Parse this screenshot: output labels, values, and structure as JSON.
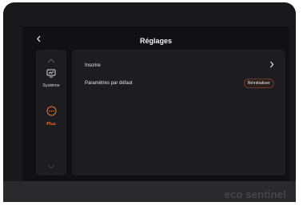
{
  "header": {
    "title": "Réglages",
    "back_icon": "chevron-left-icon"
  },
  "sidebar": {
    "items": [
      {
        "label": "Système",
        "icon": "monitor-icon",
        "active": false,
        "color": "#d8d8d8"
      },
      {
        "label": "Plus",
        "icon": "more-dots-icon",
        "active": true,
        "color": "#f06a2a"
      }
    ]
  },
  "settings": {
    "rows": [
      {
        "label": "Inscrire",
        "action_icon": "chevron-right-icon"
      },
      {
        "label": "Paramètres par défaut",
        "button_label": "Réinitialiser"
      }
    ]
  },
  "device": {
    "brand": "eco sentinel"
  },
  "colors": {
    "accent": "#f06a2a",
    "panel": "#1d1d21",
    "screen": "#111114"
  }
}
